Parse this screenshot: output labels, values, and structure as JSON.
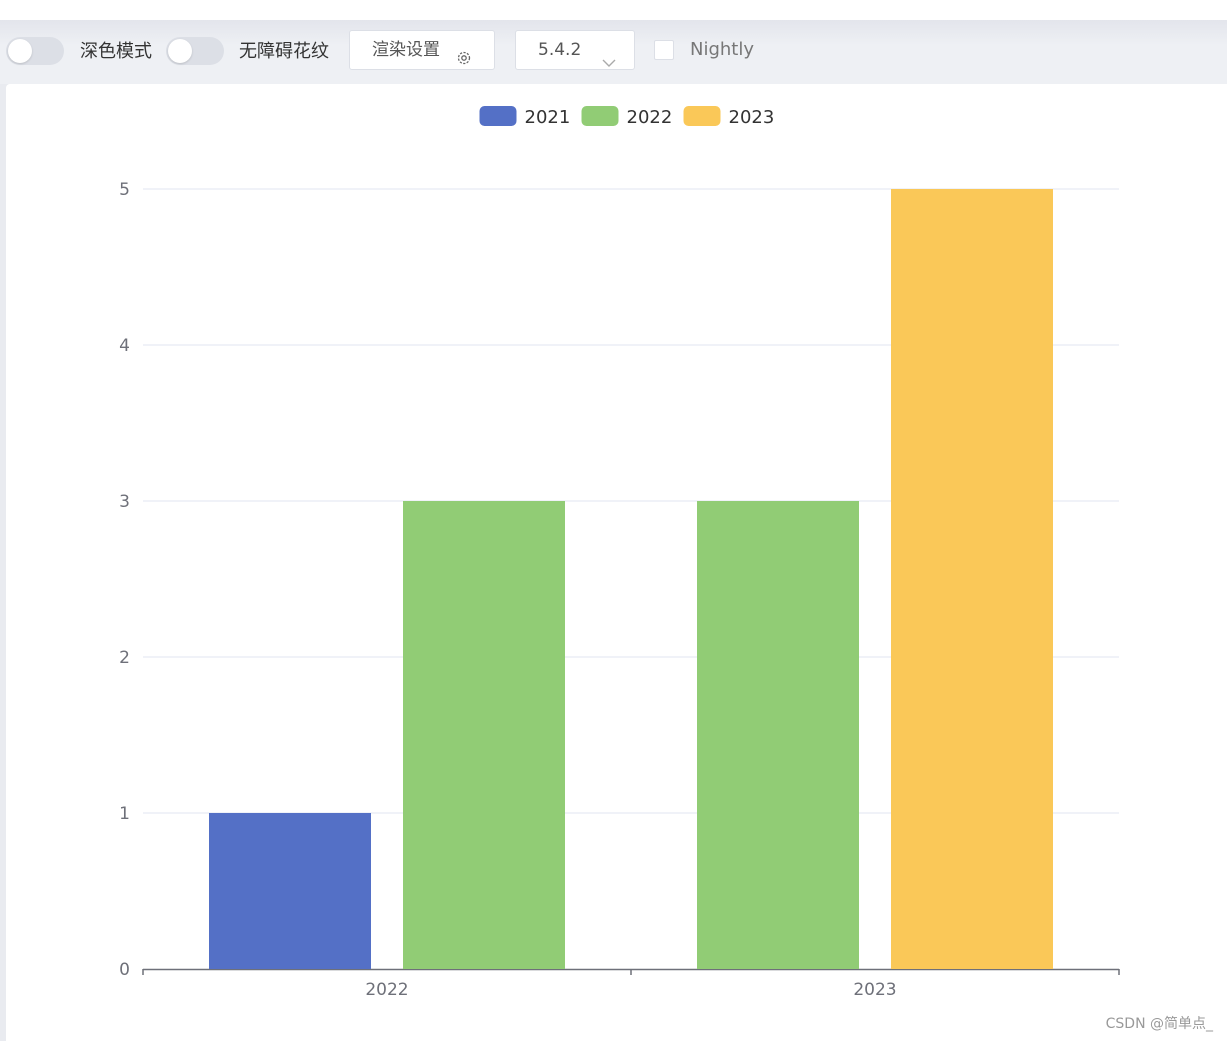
{
  "toolbar": {
    "dark_mode_label": "深色模式",
    "decal_label": "无障碍花纹",
    "render_settings_label": "渲染设置",
    "version_value": "5.4.2",
    "nightly_label": "Nightly"
  },
  "watermark": "CSDN @简单点_",
  "colors": {
    "series_2021": "#5470c6",
    "series_2022": "#91cc75",
    "series_2023": "#fac858"
  },
  "chart_data": {
    "type": "bar",
    "categories": [
      "2022",
      "2023"
    ],
    "series": [
      {
        "name": "2021",
        "color": "#5470c6",
        "values": [
          1,
          null
        ]
      },
      {
        "name": "2022",
        "color": "#91cc75",
        "values": [
          3,
          3
        ]
      },
      {
        "name": "2023",
        "color": "#fac858",
        "values": [
          null,
          5
        ]
      }
    ],
    "y_ticks": [
      "0",
      "1",
      "2",
      "3",
      "4",
      "5"
    ],
    "ylim": [
      0,
      5
    ],
    "grid": true,
    "legend": "top-center"
  }
}
